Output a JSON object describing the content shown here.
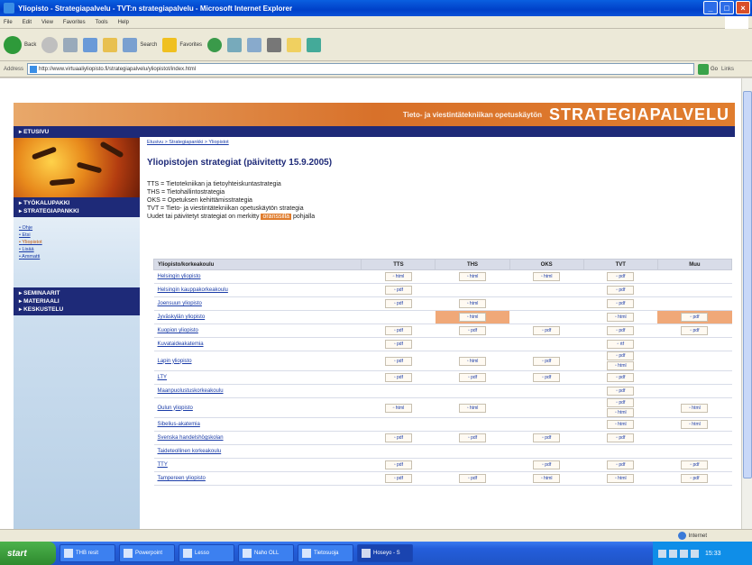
{
  "window": {
    "title": "Yliopisto - Strategiapalvelu - TVT:n strategiapalvelu - Microsoft Internet Explorer"
  },
  "menu": [
    "File",
    "Edit",
    "View",
    "Favorites",
    "Tools",
    "Help"
  ],
  "toolbar": {
    "back": "Back",
    "search": "Search",
    "favorites": "Favorites"
  },
  "address": {
    "label": "Address",
    "url": "http://www.virtuaaliyliopisto.fi/strategiapalvelu/yliopistot/index.html",
    "go": "Go",
    "links": "Links"
  },
  "header": {
    "tagline": "Tieto- ja viestintätekniikan opetuskäytön",
    "title": "STRATEGIAPALVELU"
  },
  "sidebar": {
    "top": "ETUSIVU",
    "nav1": [
      "TYÖKALUPAKKI",
      "STRATEGIAPANKKI"
    ],
    "links": [
      "Ohje",
      "Etsi",
      "Yliopistot",
      "Lisää",
      "Ammatti"
    ],
    "nav2": [
      "SEMINAARIT",
      "MATERIAALI",
      "KESKUSTELU"
    ]
  },
  "main": {
    "breadcrumb": "Etusivu > Strategiapankki > Yliopistot",
    "title": "Yliopistojen strategiat (päivitetty 15.9.2005)",
    "abbr": [
      "TTS = Tietotekniikan ja tietoyhteiskuntastrategia",
      "THS = Tietohallintostrategia",
      "OKS = Opetuksen kehittämisstrategia",
      "TVT = Tieto- ja viestintätekniikan opetuskäytön strategia"
    ],
    "note_before": "Uudet tai päivitetyt strategiat on merkitty",
    "note_hl": "oranssilla",
    "note_after": "pohjalla"
  },
  "table": {
    "headers": [
      "Yliopisto/korkeakoulu",
      "TTS",
      "THS",
      "OKS",
      "TVT",
      "Muu"
    ],
    "rows": [
      {
        "name": "Helsingin yliopisto",
        "cells": [
          [
            "html"
          ],
          [
            "html"
          ],
          [
            "html"
          ],
          [
            "pdf"
          ],
          []
        ]
      },
      {
        "name": "Helsingin kauppakorkeakoulu",
        "cells": [
          [
            "pdf"
          ],
          [],
          [],
          [
            "pdf"
          ],
          []
        ]
      },
      {
        "name": "Joensuun yliopisto",
        "cells": [
          [
            "pdf"
          ],
          [
            "html"
          ],
          [],
          [
            "pdf"
          ],
          []
        ]
      },
      {
        "name": "Jyväskylän yliopisto",
        "cells": [
          [],
          [
            "html"
          ],
          [],
          [
            "html"
          ],
          [
            "pdf"
          ]
        ],
        "hilite": [
          1,
          4
        ]
      },
      {
        "name": "Kuopion yliopisto",
        "cells": [
          [
            "pdf"
          ],
          [
            "pdf"
          ],
          [
            "pdf"
          ],
          [
            "pdf"
          ],
          [
            "pdf"
          ]
        ]
      },
      {
        "name": "Kuvataideakatemia",
        "cells": [
          [
            "pdf"
          ],
          [],
          [],
          [
            "rtf"
          ],
          []
        ]
      },
      {
        "name": "Lapin yliopisto",
        "cells": [
          [
            "pdf"
          ],
          [
            "html"
          ],
          [
            "pdf"
          ],
          [
            "pdf",
            "html"
          ],
          []
        ]
      },
      {
        "name": "LTY",
        "cells": [
          [
            "pdf"
          ],
          [
            "pdf"
          ],
          [
            "pdf"
          ],
          [
            "pdf"
          ],
          []
        ]
      },
      {
        "name": "Maanpuolustuskorkeakoulu",
        "cells": [
          [],
          [],
          [],
          [
            "pdf"
          ],
          []
        ]
      },
      {
        "name": "Oulun yliopisto",
        "cells": [
          [
            "html"
          ],
          [
            "html"
          ],
          [],
          [
            "pdf",
            "html"
          ],
          [
            "html"
          ]
        ]
      },
      {
        "name": "Sibelius-akatemia",
        "cells": [
          [],
          [],
          [],
          [
            "html"
          ],
          [
            "html"
          ]
        ]
      },
      {
        "name": "Svenska handelshögskolan",
        "cells": [
          [
            "pdf"
          ],
          [
            "pdf"
          ],
          [
            "pdf"
          ],
          [
            "pdf"
          ],
          []
        ]
      },
      {
        "name": "Taideteollinen korkeakoulu",
        "cells": [
          [],
          [],
          [],
          [],
          []
        ]
      },
      {
        "name": "TTY",
        "cells": [
          [
            "pdf"
          ],
          [],
          [
            "pdf"
          ],
          [
            "pdf"
          ],
          [
            "pdf"
          ]
        ]
      },
      {
        "name": "Tampereen yliopisto",
        "cells": [
          [
            "pdf"
          ],
          [
            "pdf"
          ],
          [
            "html"
          ],
          [
            "html"
          ],
          [
            "pdf"
          ]
        ]
      }
    ]
  },
  "status": {
    "zone": "Internet"
  },
  "taskbar": {
    "start": "start",
    "tasks": [
      "THB resit",
      "Powerpoint",
      "Lesso",
      "Naho OLL",
      "Tietosuoja",
      "Hoseyo - S"
    ],
    "clock": "15:33"
  }
}
